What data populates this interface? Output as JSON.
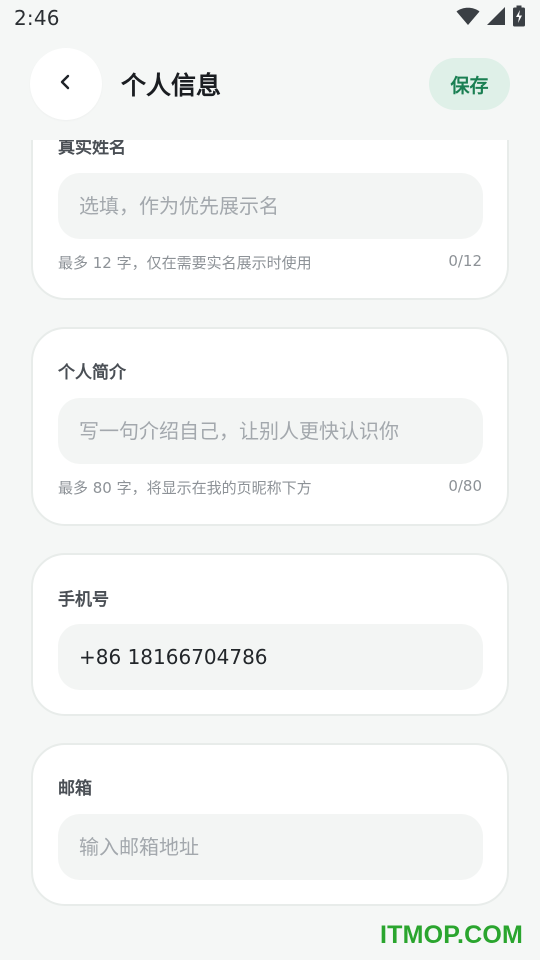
{
  "status_bar": {
    "time": "2:46",
    "icons": [
      "wifi-icon",
      "cellular-signal-icon",
      "battery-charging-icon"
    ]
  },
  "header": {
    "back_icon": "chevron-left-icon",
    "title": "个人信息",
    "save_label": "保存"
  },
  "cards": {
    "real_name": {
      "label": "真实姓名",
      "placeholder": "选填，作为优先展示名",
      "value": "",
      "hint": "最多 12 字，仅在需要实名展示时使用",
      "counter": "0/12"
    },
    "bio": {
      "label": "个人简介",
      "placeholder": "写一句介绍自己，让别人更快认识你",
      "value": "",
      "hint": "最多 80 字，将显示在我的页昵称下方",
      "counter": "0/80"
    },
    "phone": {
      "label": "手机号",
      "value": "+86 18166704786"
    },
    "email": {
      "label": "邮箱",
      "placeholder": "输入邮箱地址",
      "value": ""
    }
  },
  "watermark": "ITMOP.COM",
  "colors": {
    "accent": "#1a7f52",
    "accent_bg": "#dff0e8",
    "background": "#f5f7f6",
    "card": "#ffffff",
    "field": "#f3f5f4",
    "watermark": "#2aa52e"
  }
}
